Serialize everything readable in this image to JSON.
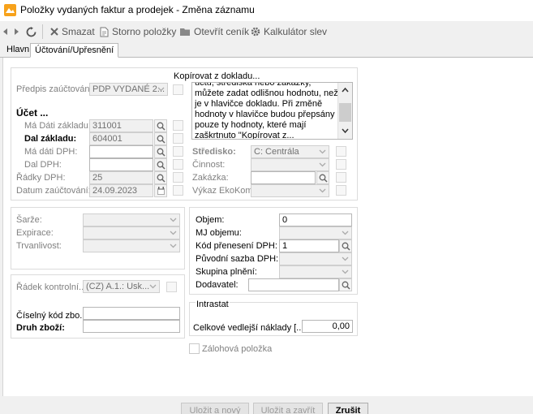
{
  "window": {
    "title": "Položky vydaných faktur a prodejek - Změna záznamu"
  },
  "toolbar": {
    "delete_label": "Smazat",
    "storno_label": "Storno položky",
    "pricelist_label": "Otevřít ceník",
    "calculator_label": "Kalkulátor slev"
  },
  "tabs": [
    {
      "label": "Hlavní"
    },
    {
      "label": "Účtování/Upřesnění"
    }
  ],
  "accounting": {
    "predpis_label": "Předpis zaúčtování:",
    "predpis_value": "PDP VYDANÉ 2...",
    "ucet_heading": "Účet ...",
    "ma_dati_zakladu_label": "Má Dáti základu:",
    "ma_dati_zakladu_value": "311001",
    "dal_zakladu_label": "Dal základu:",
    "dal_zakladu_value": "604001",
    "ma_dati_dph_label": "Má dáti DPH:",
    "ma_dati_dph_value": "",
    "dal_dph_label": "Dal DPH:",
    "dal_dph_value": "",
    "radky_dph_label": "Řádky DPH:",
    "radky_dph_value": "25",
    "datum_label": "Datum zaúčtování:",
    "datum_value": "24.09.2023"
  },
  "copy": {
    "heading": "Kopírovat z dokladu...",
    "text_lines": [
      "účtu, střediska nebo zakázky,",
      "můžete zadat odlišnou hodnotu, než",
      "je v hlavičce dokladu. Při změně",
      "hodnoty v hlavičce budou přepsány",
      "pouze ty hodnoty, které mají",
      "zaškrtnuto \"Kopírovat z..."
    ]
  },
  "cost": {
    "stredisko_label": "Středisko:",
    "stredisko_value": "C: Centrála",
    "cinnost_label": "Činnost:",
    "zakazka_label": "Zakázka:",
    "vykaz_label": "Výkaz EkoKom:"
  },
  "batch": {
    "sarze_label": "Šarže:",
    "expirace_label": "Expirace:",
    "trvanlivost_label": "Trvanlivost:"
  },
  "control": {
    "radek_label": "Řádek kontrolní...",
    "radek_value": "(CZ) A.1.: Usk...",
    "ciselny_label": "Číselný kód zbo...",
    "druh_label": "Druh zboží:"
  },
  "vat": {
    "objem_label": "Objem:",
    "objem_value": "0",
    "mj_label": "MJ objemu:",
    "kod_label": "Kód přenesení DPH:",
    "kod_value": "1",
    "puvodni_label": "Původní sazba DPH:",
    "skupina_label": "Skupina plnění:",
    "dodavatel_label": "Dodavatel:"
  },
  "intrastat": {
    "heading": "Intrastat",
    "naklady_label": "Celkové vedlejší náklady [...",
    "naklady_value": "0,00"
  },
  "zalohova_label": "Zálohová položka",
  "buttons": {
    "save_new": "Uložit a nový",
    "save_close": "Uložit a zavřít",
    "cancel": "Zrušit"
  },
  "colors": {
    "accent": "#f7a21b"
  }
}
